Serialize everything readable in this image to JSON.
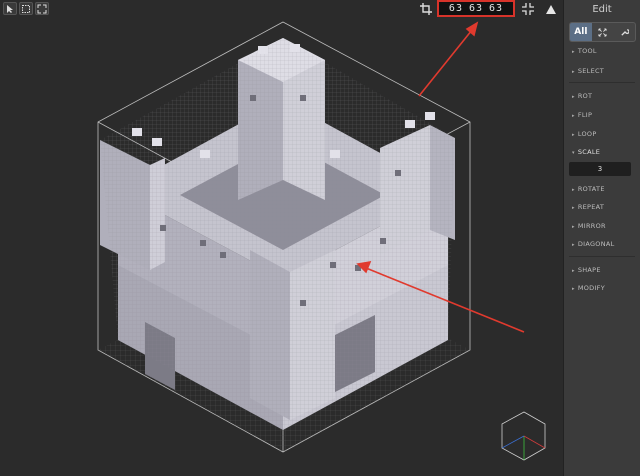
{
  "toolbar": {
    "tools": [
      "arrow-icon",
      "box-select-icon",
      "expand-icon"
    ],
    "size": {
      "x": "63",
      "y": "63",
      "z": "63"
    }
  },
  "sidebar": {
    "title": "Edit",
    "modes": [
      "All",
      "expand-icon",
      "wrench-icon"
    ],
    "sections": [
      "TOOL",
      "SELECT",
      "ROT",
      "FLIP",
      "LOOP",
      "SCALE",
      "ROTATE",
      "REPEAT",
      "MIRROR",
      "DIAGONAL",
      "SHAPE",
      "MODIFY"
    ],
    "scale_value": "3"
  },
  "colors": {
    "accent": "#5c6f86",
    "highlight": "#d8332a",
    "voxel": "#b9b8c4"
  }
}
